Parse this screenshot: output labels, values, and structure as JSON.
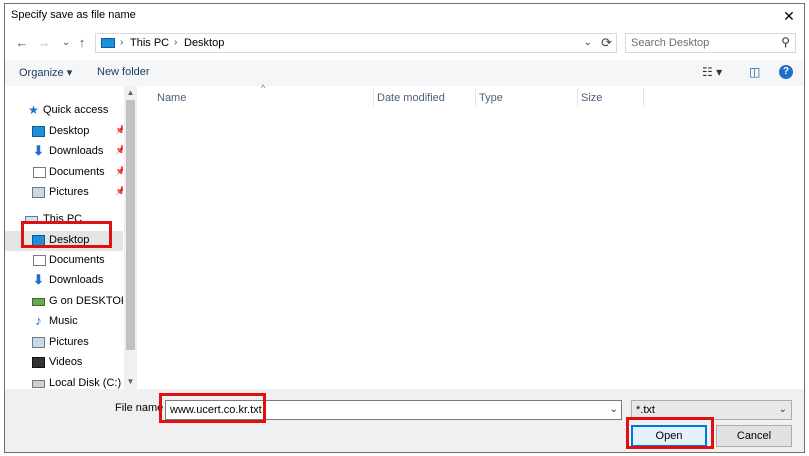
{
  "window": {
    "title": "Specify save as file name"
  },
  "titlebar": {
    "close_glyph": "✕"
  },
  "nav": {
    "back_glyph": "←",
    "forward_glyph": "→",
    "recent_glyph": "⌄",
    "up_glyph": "↑",
    "breadcrumbs": [
      "This PC",
      "Desktop"
    ],
    "crumb_sep": "›",
    "dropdown_glyph": "⌄",
    "refresh_glyph": "⟳"
  },
  "search": {
    "placeholder": "Search Desktop",
    "icon": "search-icon",
    "glyph": "⚲"
  },
  "toolbar": {
    "organize_label": "Organize ▾",
    "new_folder_label": "New folder",
    "view_glyph": "☷ ▾",
    "preview_glyph": "◫",
    "help_glyph": "?"
  },
  "sidebar": {
    "quick_access_label": "Quick access",
    "quick_items": [
      {
        "label": "Desktop",
        "icon": "desktop-icon"
      },
      {
        "label": "Downloads",
        "icon": "download-icon"
      },
      {
        "label": "Documents",
        "icon": "documents-icon"
      },
      {
        "label": "Pictures",
        "icon": "pictures-icon"
      }
    ],
    "pin_glyph": "📌",
    "this_pc_label": "This PC",
    "pc_items": [
      {
        "label": "Desktop",
        "icon": "desktop-icon",
        "selected": true
      },
      {
        "label": "Documents",
        "icon": "documents-icon"
      },
      {
        "label": "Downloads",
        "icon": "download-icon"
      },
      {
        "label": "G on DESKTOP-C",
        "icon": "network-drive-icon"
      },
      {
        "label": "Music",
        "icon": "music-icon"
      },
      {
        "label": "Pictures",
        "icon": "pictures-icon"
      },
      {
        "label": "Videos",
        "icon": "videos-icon"
      },
      {
        "label": "Local Disk (C:)",
        "icon": "drive-icon"
      }
    ],
    "star_glyph": "★",
    "down_glyph": "⬇",
    "music_glyph": "♪"
  },
  "scrollbar": {
    "up_glyph": "▲",
    "down_glyph": "▼"
  },
  "filelist": {
    "columns": [
      "Name",
      "Date modified",
      "Type",
      "Size"
    ],
    "sort_glyph": "^"
  },
  "footer": {
    "filename_label": "File name",
    "filename_value": "www.ucert.co.kr.txt",
    "filename_dropdown_glyph": "⌄",
    "filter_value": "*.txt",
    "filter_dropdown_glyph": "⌄",
    "open_label": "Open",
    "cancel_label": "Cancel"
  },
  "colors": {
    "accent": "#0078d7",
    "highlight": "#e01010",
    "selected_bg": "#e5e5e5"
  }
}
